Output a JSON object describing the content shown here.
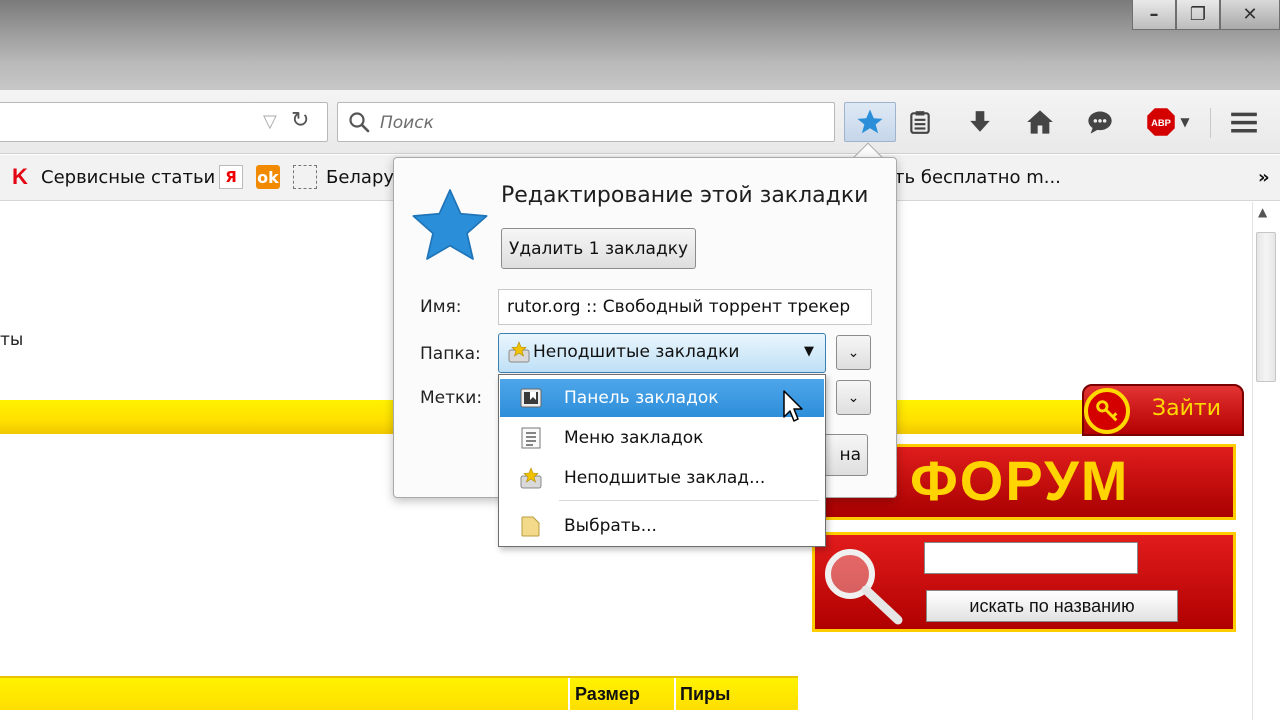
{
  "search": {
    "placeholder": "Поиск"
  },
  "bookmarks_bar": {
    "items": [
      {
        "label": "Сервисные статьи"
      },
      {
        "label": "Белару"
      },
      {
        "label": "ать бесплатно m..."
      }
    ],
    "overflow": "»"
  },
  "page": {
    "left_fragment": "ты",
    "login_label": "Зайти",
    "forum_label": "ФОРУМ",
    "search_button_label": "искать по названию",
    "table_headers": [
      "Размер",
      "Пиры"
    ]
  },
  "bookmark_panel": {
    "title": "Редактирование этой закладки",
    "remove_button": "Удалить 1 закладку",
    "name_label": "Имя:",
    "name_value": "rutor.org :: Свободный торрент трекер",
    "folder_label": "Папка:",
    "folder_value": "Неподшитые закладки",
    "tags_label": "Метки:",
    "done_peek": "на"
  },
  "folder_dropdown": {
    "items": [
      {
        "label": "Панель закладок",
        "icon": "bookmarks-toolbar-icon",
        "highlighted": true
      },
      {
        "label": "Меню закладок",
        "icon": "bookmarks-menu-icon"
      },
      {
        "label": "Неподшитые заклад...",
        "icon": "unsorted-bookmarks-icon"
      },
      {
        "label": "Выбрать...",
        "icon": "folder-icon"
      }
    ]
  },
  "colors": {
    "accent_blue": "#2e8ed9",
    "star_blue": "#2a8fd8",
    "site_yellow": "#ffe000",
    "site_red": "#c40000"
  }
}
